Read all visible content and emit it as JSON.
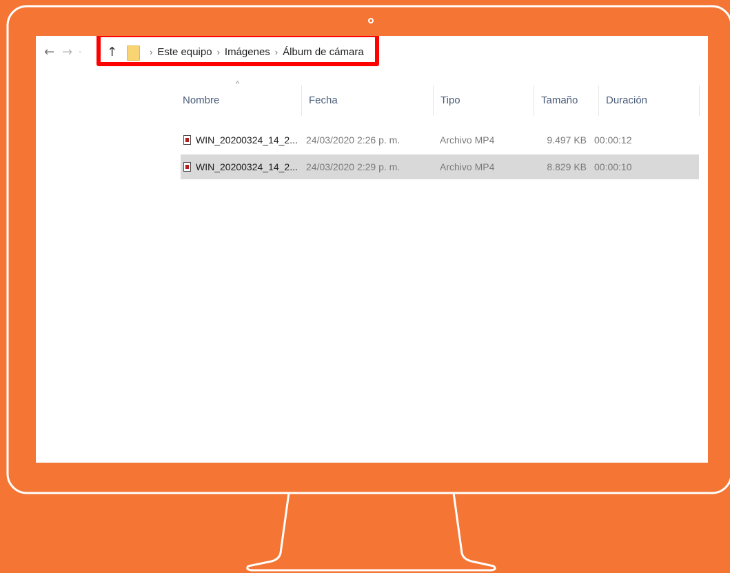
{
  "colors": {
    "background": "#F47534",
    "monitor_outline": "#FFFFFF",
    "highlight": "#FF0000",
    "selected_row": "#D9D9D9"
  },
  "icons": {
    "back": "back-arrow-icon",
    "forward": "forward-arrow-icon",
    "recent": "recent-locations-chevron-icon",
    "up": "up-arrow-icon",
    "folder": "folder-icon",
    "file": "mp4-file-icon"
  },
  "nav": {
    "back_glyph": "←",
    "forward_glyph": "→",
    "recent_glyph": "˅",
    "up_glyph": "↑"
  },
  "breadcrumb": {
    "separator": "›",
    "items": [
      {
        "label": "Este equipo"
      },
      {
        "label": "Imágenes"
      },
      {
        "label": "Álbum de cámara"
      }
    ]
  },
  "file_list": {
    "sort_indicator": "^",
    "columns": [
      {
        "label": "Nombre"
      },
      {
        "label": "Fecha"
      },
      {
        "label": "Tipo"
      },
      {
        "label": "Tamaño"
      },
      {
        "label": "Duración"
      }
    ],
    "rows": [
      {
        "name": "WIN_20200324_14_2...",
        "date": "24/03/2020 2:26 p. m.",
        "type": "Archivo MP4",
        "size": "9.497 KB",
        "duration": "00:00:12",
        "selected": false
      },
      {
        "name": "WIN_20200324_14_2...",
        "date": "24/03/2020 2:29 p. m.",
        "type": "Archivo MP4",
        "size": "8.829 KB",
        "duration": "00:00:10",
        "selected": true
      }
    ]
  }
}
